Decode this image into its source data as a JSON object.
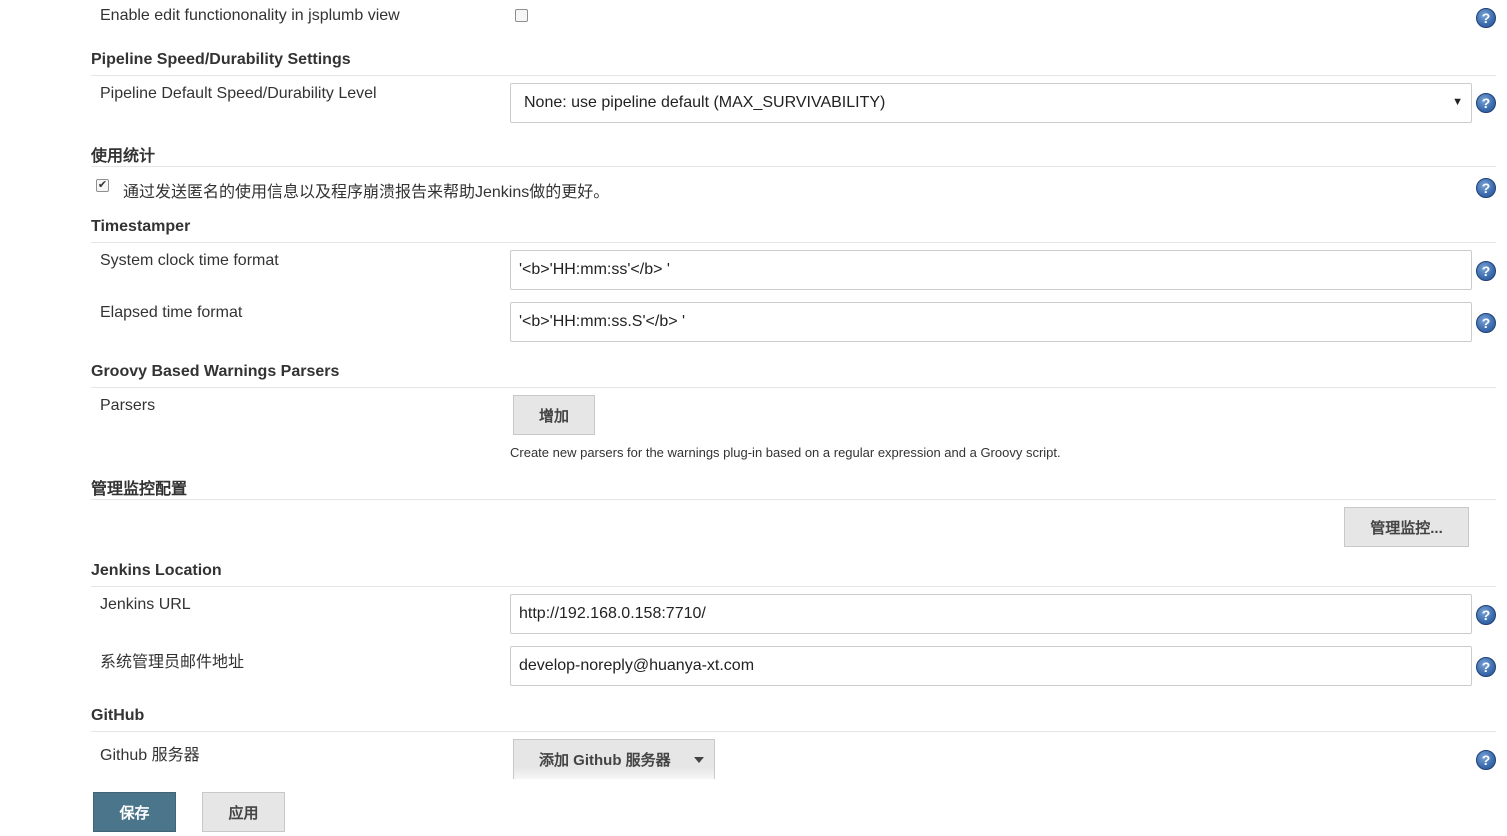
{
  "jsplumb": {
    "label": "Enable edit functiononality in jsplumb view",
    "checked": false
  },
  "pipeline": {
    "section_title": "Pipeline Speed/Durability Settings",
    "level_label": "Pipeline Default Speed/Durability Level",
    "level_value": "None: use pipeline default (MAX_SURVIVABILITY)"
  },
  "usage": {
    "section_title": "使用统计",
    "checkbox_label": "通过发送匿名的使用信息以及程序崩溃报告来帮助Jenkins做的更好。",
    "checked": true
  },
  "timestamper": {
    "section_title": "Timestamper",
    "clock_label": "System clock time format",
    "clock_value": "'<b>'HH:mm:ss'</b> '",
    "elapsed_label": "Elapsed time format",
    "elapsed_value": "'<b>'HH:mm:ss.S'</b> '"
  },
  "groovy": {
    "section_title": "Groovy Based Warnings Parsers",
    "parsers_label": "Parsers",
    "add_button": "增加",
    "hint": "Create new parsers for the warnings plug-in based on a regular expression and a Groovy script."
  },
  "monitor": {
    "section_title": "管理监控配置",
    "button": "管理监控..."
  },
  "location": {
    "section_title": "Jenkins Location",
    "url_label": "Jenkins URL",
    "url_value": "http://192.168.0.158:7710/",
    "email_label": "系统管理员邮件地址",
    "email_value": "develop-noreply@huanya-xt.com"
  },
  "github": {
    "section_title": "GitHub",
    "servers_label": "Github 服务器",
    "add_button": "添加 Github 服务器"
  },
  "footer": {
    "save": "保存",
    "apply": "应用"
  },
  "help_glyph": "?",
  "colors": {
    "primary_button": "#4b758b",
    "help_icon": "#3f6fb0"
  }
}
